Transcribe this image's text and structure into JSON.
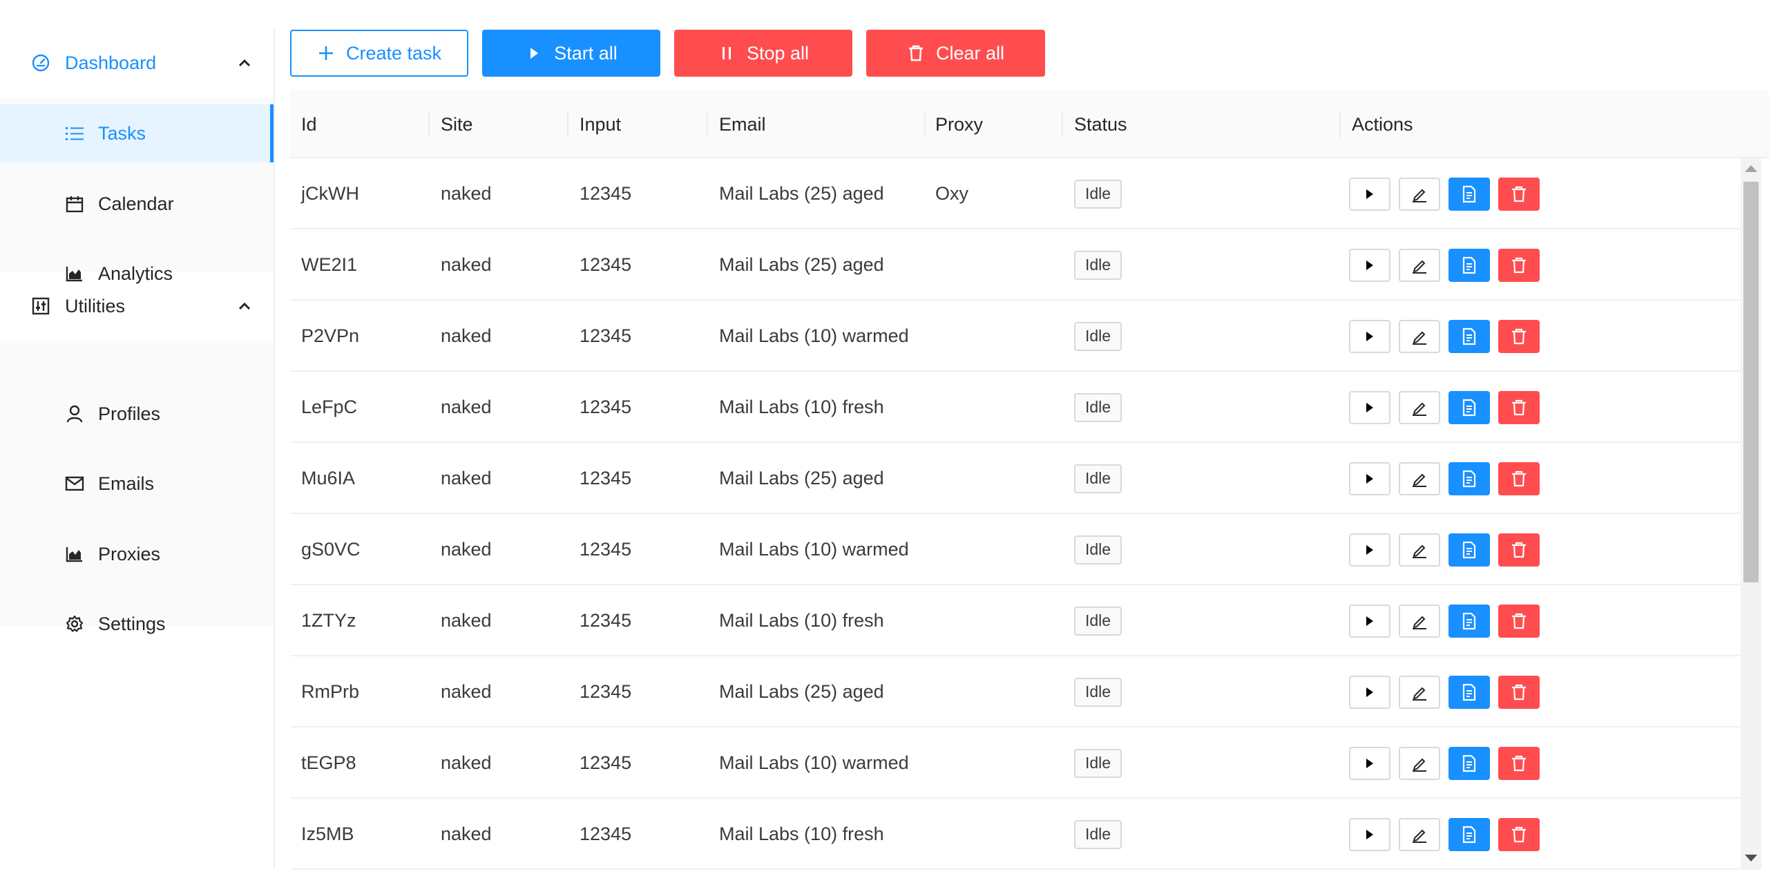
{
  "sidebar": {
    "dashboard": {
      "label": "Dashboard",
      "icon": "dashboard-icon"
    },
    "dashboard_items": [
      {
        "label": "Tasks",
        "icon": "list-icon",
        "selected": true
      },
      {
        "label": "Calendar",
        "icon": "calendar-icon"
      },
      {
        "label": "Analytics",
        "icon": "area-chart-icon"
      }
    ],
    "utilities": {
      "label": "Utilities",
      "icon": "sliders-icon"
    },
    "utilities_items": [
      {
        "label": "Profiles",
        "icon": "user-icon"
      },
      {
        "label": "Emails",
        "icon": "mail-icon"
      },
      {
        "label": "Proxies",
        "icon": "area-chart-icon"
      },
      {
        "label": "Settings",
        "icon": "gear-icon"
      }
    ]
  },
  "toolbar": {
    "create_label": "Create task",
    "start_label": "Start all",
    "stop_label": "Stop all",
    "clear_label": "Clear all"
  },
  "table": {
    "columns": [
      "Id",
      "Site",
      "Input",
      "Email",
      "Proxy",
      "Status",
      "Actions"
    ],
    "rows": [
      {
        "id": "jCkWH",
        "site": "naked",
        "input": "12345",
        "email": "Mail Labs (25) aged",
        "proxy": "Oxy",
        "status": "Idle"
      },
      {
        "id": "WE2I1",
        "site": "naked",
        "input": "12345",
        "email": "Mail Labs (25) aged",
        "proxy": "",
        "status": "Idle"
      },
      {
        "id": "P2VPn",
        "site": "naked",
        "input": "12345",
        "email": "Mail Labs (10) warmed",
        "proxy": "",
        "status": "Idle"
      },
      {
        "id": "LeFpC",
        "site": "naked",
        "input": "12345",
        "email": "Mail Labs (10) fresh",
        "proxy": "",
        "status": "Idle"
      },
      {
        "id": "Mu6IA",
        "site": "naked",
        "input": "12345",
        "email": "Mail Labs (25) aged",
        "proxy": "",
        "status": "Idle"
      },
      {
        "id": "gS0VC",
        "site": "naked",
        "input": "12345",
        "email": "Mail Labs (10) warmed",
        "proxy": "",
        "status": "Idle"
      },
      {
        "id": "1ZTYz",
        "site": "naked",
        "input": "12345",
        "email": "Mail Labs (10) fresh",
        "proxy": "",
        "status": "Idle"
      },
      {
        "id": "RmPrb",
        "site": "naked",
        "input": "12345",
        "email": "Mail Labs (25) aged",
        "proxy": "",
        "status": "Idle"
      },
      {
        "id": "tEGP8",
        "site": "naked",
        "input": "12345",
        "email": "Mail Labs (10) warmed",
        "proxy": "",
        "status": "Idle"
      },
      {
        "id": "Iz5MB",
        "site": "naked",
        "input": "12345",
        "email": "Mail Labs (10) fresh",
        "proxy": "",
        "status": "Idle"
      }
    ]
  },
  "colors": {
    "primary": "#1890ff",
    "danger": "#ff4d4f",
    "selected_bg": "#e6f4ff"
  }
}
